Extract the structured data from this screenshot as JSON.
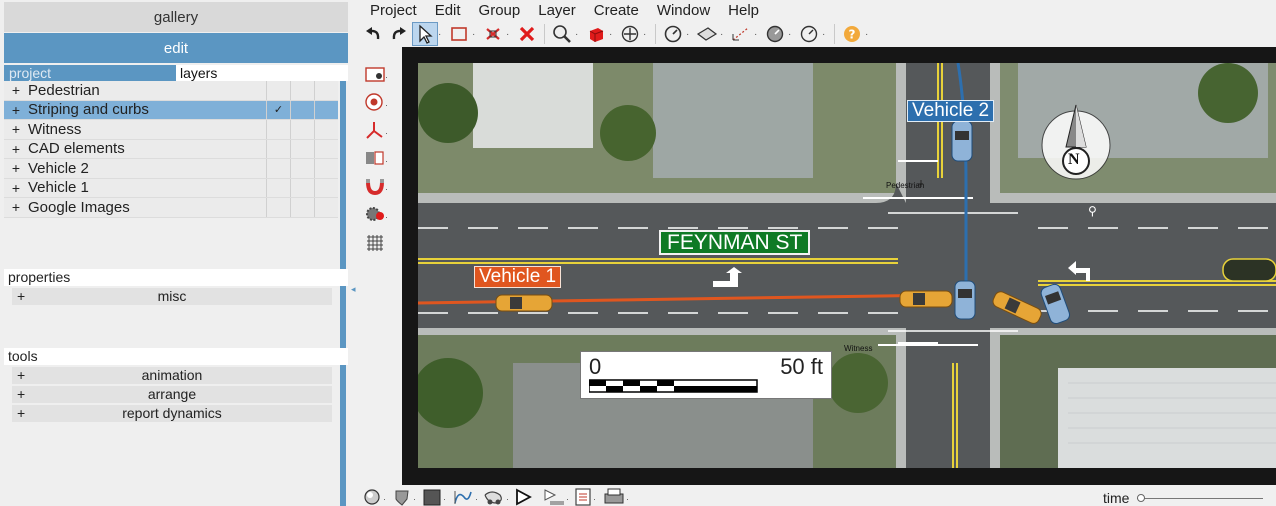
{
  "panel": {
    "gallery_label": "gallery",
    "edit_label": "edit",
    "tabs": {
      "project": "project",
      "layers": "layers"
    },
    "layers": [
      {
        "name": "Pedestrian",
        "selected": false,
        "checked": false
      },
      {
        "name": "Striping and curbs",
        "selected": true,
        "checked": true
      },
      {
        "name": "Witness",
        "selected": false,
        "checked": false
      },
      {
        "name": "CAD elements",
        "selected": false,
        "checked": false
      },
      {
        "name": "Vehicle 2",
        "selected": false,
        "checked": false
      },
      {
        "name": "Vehicle 1",
        "selected": false,
        "checked": false
      },
      {
        "name": "Google Images",
        "selected": false,
        "checked": false
      }
    ],
    "expand_symbol": "+",
    "check_symbol": "✓",
    "properties": {
      "title": "properties",
      "items": [
        "misc"
      ]
    },
    "tools": {
      "title": "tools",
      "items": [
        "animation",
        "arrange",
        "report dynamics"
      ]
    }
  },
  "menu": [
    "Project",
    "Edit",
    "Group",
    "Layer",
    "Create",
    "Window",
    "Help"
  ],
  "toolbar_icons": [
    "undo-icon",
    "redo-icon",
    "select-arrow-icon",
    "rect-select-icon",
    "delete-node-icon",
    "delete-icon",
    "zoom-icon",
    "solid-object-icon",
    "pan-icon",
    "measure-icon",
    "surface-icon",
    "dimension-icon",
    "gauge-icon",
    "dial-icon",
    "help-icon"
  ],
  "side_tools": [
    "camera-icon",
    "target-icon",
    "axis-icon",
    "flip-icon",
    "magnet-icon",
    "settings-icon",
    "grid-icon"
  ],
  "bottom_tools": [
    "sphere-icon",
    "shield-icon",
    "color-swatch-icon",
    "path-icon",
    "vehicle-path-icon",
    "play-icon",
    "step-icon",
    "report-icon",
    "print-icon"
  ],
  "map": {
    "street_name": "FEYNMAN ST",
    "vehicle1_label": "Vehicle 1",
    "vehicle2_label": "Vehicle 2",
    "scale_start": "0",
    "scale_end": "50 ft",
    "pedestrian_label": "Pedestrian",
    "witness_label": "Witness",
    "compass_letter": "N",
    "colors": {
      "vehicle1": "#e0561f",
      "vehicle2": "#2d6fae",
      "street_sign": "#0f7a25"
    }
  },
  "timeline": {
    "label": "time",
    "position": 0
  }
}
